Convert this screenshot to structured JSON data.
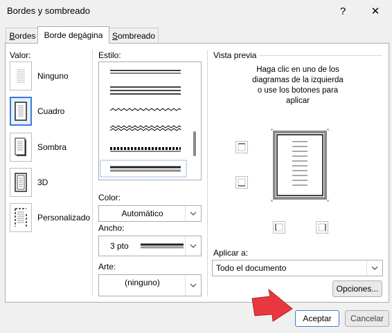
{
  "window": {
    "title": "Bordes y sombreado",
    "help_glyph": "?",
    "close_glyph": "✕"
  },
  "tabs": [
    {
      "label": "Bordes",
      "underline": "B",
      "rest": "ordes"
    },
    {
      "label": "Borde de página",
      "underline": "p",
      "pre": "Borde de ",
      "rest": "ágina"
    },
    {
      "label": "Sombreado",
      "underline": "S",
      "rest": "ombreado"
    }
  ],
  "setting": {
    "label": "Valor:",
    "items": [
      {
        "label": "Ninguno",
        "icon": "none-border-icon",
        "selected": false
      },
      {
        "label": "Cuadro",
        "icon": "box-border-icon",
        "selected": true
      },
      {
        "label": "Sombra",
        "icon": "shadow-border-icon",
        "selected": false
      },
      {
        "label": "3D",
        "icon": "3d-border-icon",
        "selected": false
      },
      {
        "label": "Personalizado",
        "icon": "custom-border-icon",
        "selected": false
      }
    ]
  },
  "style": {
    "label": "Estilo:",
    "color_label": "Color:",
    "color_value": "Automático",
    "width_label": "Ancho:",
    "width_value": "3 pto",
    "art_label": "Arte:",
    "art_value": "(ninguno)"
  },
  "preview": {
    "label": "Vista previa",
    "hint": "Haga clic en uno de los diagramas de la izquierda o use los botones para aplicar",
    "apply_label": "Aplicar a:",
    "apply_value": "Todo el documento"
  },
  "buttons": {
    "options": "Opciones...",
    "ok": "Aceptar",
    "cancel": "Cancelar"
  },
  "colors": {
    "accent": "#3a7bd5",
    "arrow": "#e8383d"
  }
}
